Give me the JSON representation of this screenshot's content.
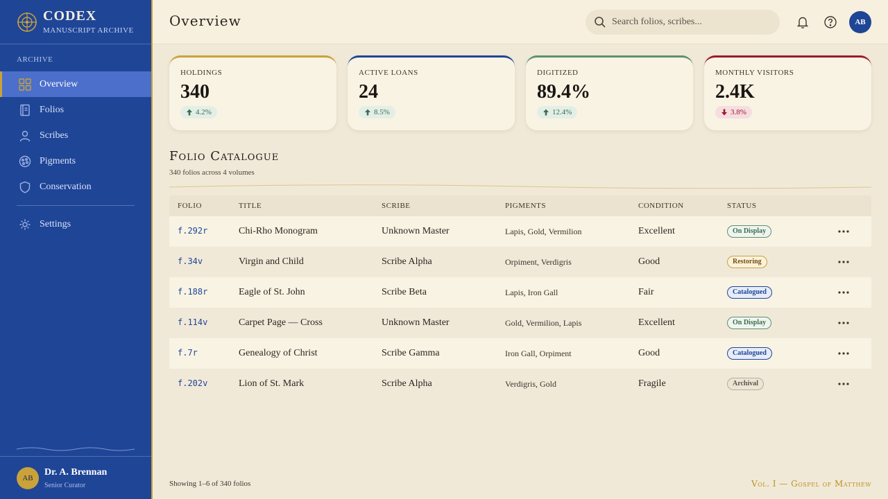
{
  "brand": {
    "title": "CODEX",
    "subtitle": "Manuscript Archive"
  },
  "sidebar": {
    "section_label": "ARCHIVE",
    "items": [
      {
        "label": "Overview",
        "icon": "grid-icon",
        "active": true
      },
      {
        "label": "Folios",
        "icon": "book-icon",
        "active": false
      },
      {
        "label": "Scribes",
        "icon": "person-icon",
        "active": false
      },
      {
        "label": "Pigments",
        "icon": "palette-icon",
        "active": false
      },
      {
        "label": "Conservation",
        "icon": "shield-icon",
        "active": false
      }
    ],
    "settings_label": "Settings",
    "user": {
      "initials": "AB",
      "name": "Dr. A. Brennan",
      "role": "Senior Curator"
    }
  },
  "header": {
    "title": "Overview",
    "search_placeholder": "Search folios, scribes...",
    "avatar_initials": "AB"
  },
  "stats": [
    {
      "label": "HOLDINGS",
      "value": "340",
      "change": "4.2%",
      "direction": "up",
      "accent": "#c9a23a"
    },
    {
      "label": "ACTIVE LOANS",
      "value": "24",
      "change": "8.5%",
      "direction": "up",
      "accent": "#1f4597"
    },
    {
      "label": "DIGITIZED",
      "value": "89.4%",
      "change": "12.4%",
      "direction": "up",
      "accent": "#5e8f70"
    },
    {
      "label": "MONTHLY VISITORS",
      "value": "2.4K",
      "change": "3.8%",
      "direction": "down",
      "accent": "#9b1a28"
    }
  ],
  "catalogue": {
    "title": "Folio Catalogue",
    "subtitle": "340 folios across 4 volumes",
    "columns": [
      "FOLIO",
      "TITLE",
      "SCRIBE",
      "PIGMENTS",
      "CONDITION",
      "STATUS"
    ],
    "rows": [
      {
        "folio": "f.292r",
        "title": "Chi-Rho Monogram",
        "scribe": "Unknown Master",
        "pigments": "Lapis, Gold, Vermilion",
        "condition": "Excellent",
        "status": "On Display",
        "status_type": "display"
      },
      {
        "folio": "f.34v",
        "title": "Virgin and Child",
        "scribe": "Scribe Alpha",
        "pigments": "Orpiment, Verdigris",
        "condition": "Good",
        "status": "Restoring",
        "status_type": "restoring"
      },
      {
        "folio": "f.188r",
        "title": "Eagle of St. John",
        "scribe": "Scribe Beta",
        "pigments": "Lapis, Iron Gall",
        "condition": "Fair",
        "status": "Catalogued",
        "status_type": "catalogued"
      },
      {
        "folio": "f.114v",
        "title": "Carpet Page — Cross",
        "scribe": "Unknown Master",
        "pigments": "Gold, Vermilion, Lapis",
        "condition": "Excellent",
        "status": "On Display",
        "status_type": "display"
      },
      {
        "folio": "f.7r",
        "title": "Genealogy of Christ",
        "scribe": "Scribe Gamma",
        "pigments": "Iron Gall, Orpiment",
        "condition": "Good",
        "status": "Catalogued",
        "status_type": "catalogued"
      },
      {
        "folio": "f.202v",
        "title": "Lion of St. Mark",
        "scribe": "Scribe Alpha",
        "pigments": "Verdigris, Gold",
        "condition": "Fragile",
        "status": "Archival",
        "status_type": "archival"
      }
    ]
  },
  "footer": {
    "showing": "Showing 1–6 of 340 folios",
    "volume": "Vol. I — Gospel of Matthew"
  },
  "colors": {
    "sidebar": "#1f4597",
    "gold": "#c9a23a",
    "parchment": "#f1e9d8"
  }
}
